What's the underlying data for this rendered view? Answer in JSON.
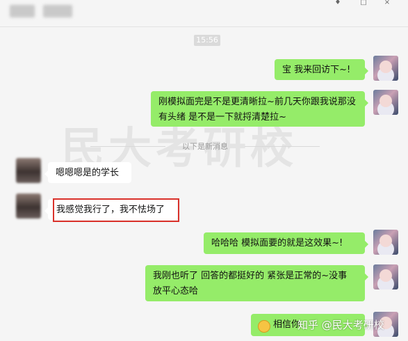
{
  "header": {
    "title": "",
    "pin_icon": "pin-icon",
    "more_icon": "more-icon"
  },
  "timestamp": "15:56",
  "divider": {
    "text": "以下是新消息"
  },
  "watermark": "民大考研校",
  "credit": "知乎 @民大考研校",
  "messages": [
    {
      "side": "right",
      "text": "宝 我来回访下~!"
    },
    {
      "side": "right",
      "text": "刚模拟面完是不是更清晰拉~前几天你跟我说那没有头绪  是不是一下就捋清楚拉~"
    },
    {
      "side": "left",
      "text": "嗯嗯嗯是的学长"
    },
    {
      "side": "left",
      "text": "我感觉我行了，我不怯场了",
      "highlighted": true
    },
    {
      "side": "right",
      "text": "哈哈哈  模拟面要的就是这效果~!"
    },
    {
      "side": "right",
      "text": "我刚也听了  回答的都挺好的    紧张是正常的~没事  放平心态哈"
    },
    {
      "side": "right",
      "text": "相信你",
      "emoji": "smile-emoji"
    }
  ],
  "colors": {
    "sent_bubble": "#95ec69",
    "received_bubble": "#ffffff",
    "highlight": "#d9312a"
  }
}
